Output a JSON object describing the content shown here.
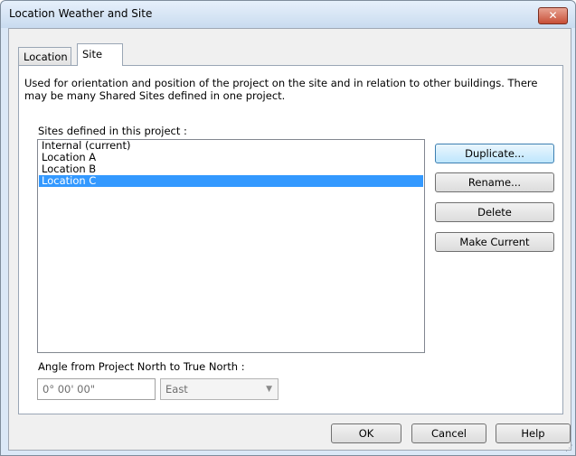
{
  "window": {
    "title": "Location Weather and Site",
    "close_glyph": "✕"
  },
  "tabs": [
    {
      "label": "Location",
      "active": false
    },
    {
      "label": "Site",
      "active": true
    }
  ],
  "site_tab": {
    "description": "Used for orientation and position of the project on the site and in relation to other buildings. There may be many Shared Sites defined in one project.",
    "sites_label": "Sites defined in this project :",
    "sites": [
      {
        "name": "Internal (current)",
        "selected": false
      },
      {
        "name": "Location A",
        "selected": false
      },
      {
        "name": "Location B",
        "selected": false
      },
      {
        "name": "Location C",
        "selected": true
      }
    ],
    "buttons": {
      "duplicate": "Duplicate...",
      "rename": "Rename...",
      "delete": "Delete",
      "make_current": "Make Current"
    },
    "angle_label": "Angle from Project North to True North :",
    "angle_value": "0° 00' 00\"",
    "direction_value": "East"
  },
  "footer": {
    "ok": "OK",
    "cancel": "Cancel",
    "help": "Help"
  },
  "colors": {
    "selection": "#3399ff",
    "close_button": "#c74f37"
  },
  "icons": [
    "close-icon",
    "dropdown-arrow-icon",
    "resize-grip-icon"
  ]
}
